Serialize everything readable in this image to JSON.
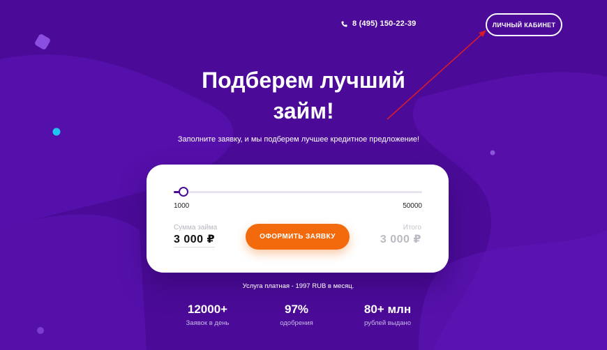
{
  "header": {
    "phone": "8 (495) 150-22-39",
    "cabinet_button": "ЛИЧНЫЙ КАБИНЕТ"
  },
  "hero": {
    "title_line1": "Подберем лучший",
    "title_line2": "займ!",
    "subtitle": "Заполните заявку, и мы подберем лучшее кредитное предложение!"
  },
  "calculator": {
    "slider_min": "1000",
    "slider_max": "50000",
    "slider_value_fraction": 0.04,
    "amount_label": "Сумма займа",
    "amount_value": "3 000 ₽",
    "submit_label": "ОФОРМИТЬ ЗАЯВКУ",
    "total_label": "Итого",
    "total_value": "3 000 ₽"
  },
  "notice": "Услуга платная - 1997 RUB в месяц.",
  "stats": [
    {
      "value": "12000+",
      "caption": "Заявок в день"
    },
    {
      "value": "97%",
      "caption": "одобрения"
    },
    {
      "value": "80+ млн",
      "caption": "рублей выдано"
    }
  ],
  "colors": {
    "background": "#4a0a96",
    "accent": "#f26a0c",
    "annotation_arrow": "#d81b2a"
  },
  "icons": {
    "phone": "phone-icon"
  }
}
